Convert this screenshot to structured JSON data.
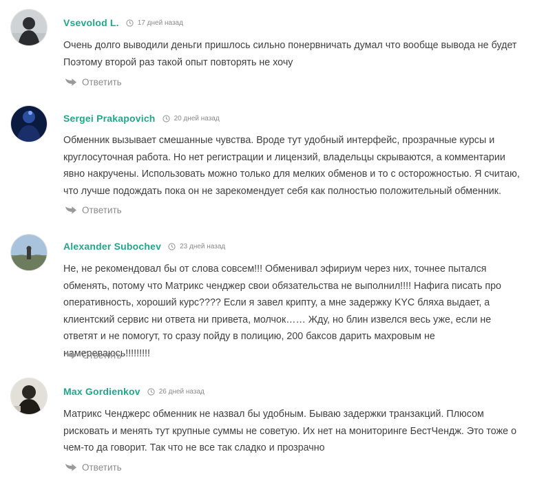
{
  "comments": [
    {
      "author": "Vsevolod L.",
      "time": "17 дней назад",
      "text": "Очень долго выводили деньги пришлось сильно понервничать думал что вообще вывода не будет Поэтому второй раз такой опыт повторять не хочу",
      "reply_label": "Ответить"
    },
    {
      "author": "Sergei Prakapovich",
      "time": "20 дней назад",
      "text": "Обменник вызывает смешанные чувства. Вроде тут удобный интерфейс, прозрачные курсы и круглосуточная работа. Но нет регистрации и лицензий, владельцы скрываются, а комментарии явно накручены. Использовать можно только для мелких обменов и то с осторожностью. Я считаю, что лучше подождать пока он не зарекомендует себя как полностью положительный обменник.",
      "reply_label": "Ответить"
    },
    {
      "author": "Alexander Subochev",
      "time": "23 дней назад",
      "text": "Не, не рекомендовал бы от слова совсем!!! Обменивал эфириум через них, точнее пытался обменять, потому что Матрикс ченджер свои обязательства не выполнил!!!! Нафига писать про оперативность, хороший курс???? Если я завел крипту, а мне задержку KYC бляха выдает, а клиентский сервис ни ответа ни привета, молчок…… Жду, но блин извелся весь уже, если не ответят и не помогут, то сразу пойду в полицию, 200 баксов дарить махровым не намереваюсь!!!!!!!!!",
      "reply_label": "Ответить"
    },
    {
      "author": "Max Gordienkov",
      "time": "26 дней назад",
      "text": "Матрикс Ченджерс обменник не назвал бы удобным. Бываю задержки транзакций. Плюсом рисковать и менять тут крупные суммы не советую. Их нет на мониторинге БестЧендж. Это тоже о чем-то да говорит. Так что не все так сладко и прозрачно",
      "reply_label": "Ответить"
    }
  ],
  "colors": {
    "author": "#21a68a",
    "text": "#3f3f3f",
    "muted": "#888888"
  },
  "icons": {
    "time": "clock-icon",
    "reply": "reply-arrow-icon"
  }
}
